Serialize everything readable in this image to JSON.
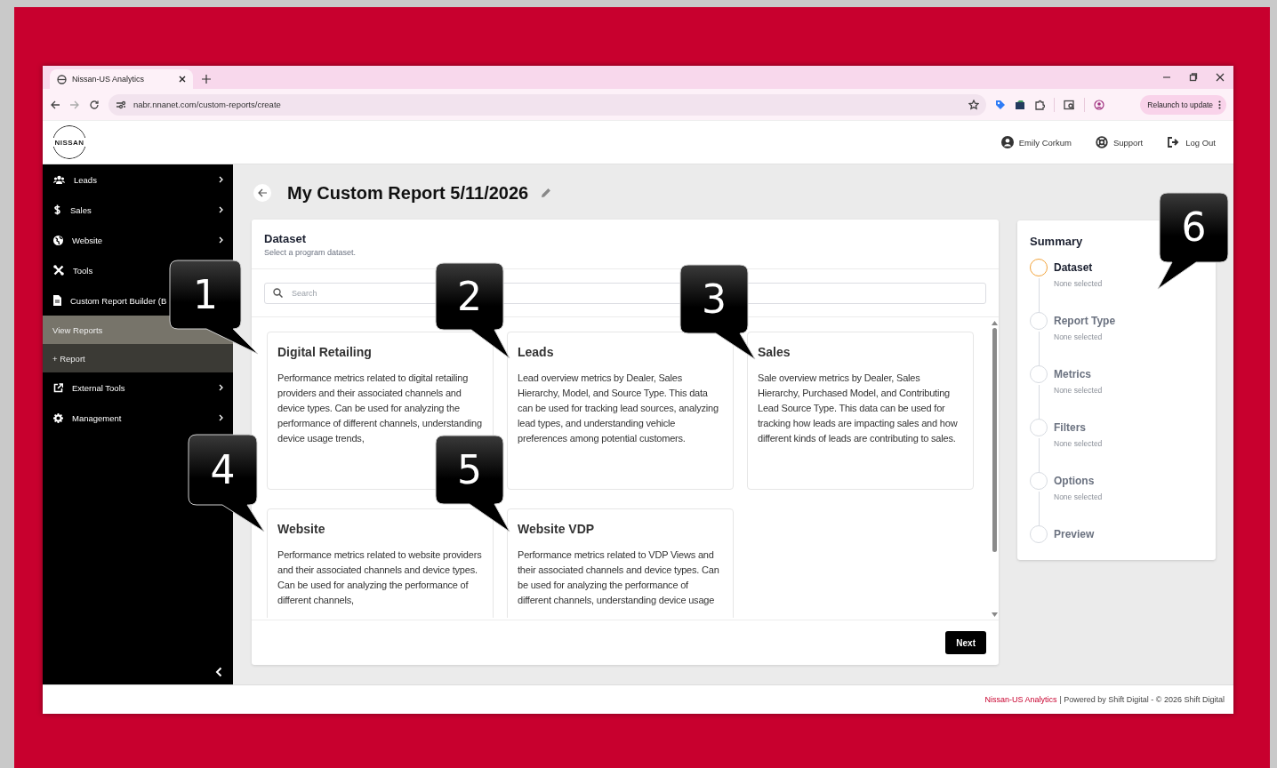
{
  "browser": {
    "tab_title": "Nissan-US Analytics",
    "address": "nabr.nnanet.com/custom-reports/create",
    "relaunch_button": "Relaunch to update"
  },
  "header": {
    "logo": "NISSAN",
    "links": [
      {
        "kind": "user",
        "label": "Emily Corkum"
      },
      {
        "kind": "support",
        "label": "Support"
      },
      {
        "kind": "logout",
        "label": "Log Out"
      }
    ]
  },
  "sidebar": {
    "items": [
      {
        "kind": "group",
        "label": "Leads"
      },
      {
        "kind": "group",
        "label": "Sales"
      },
      {
        "kind": "group",
        "label": "Website"
      },
      {
        "kind": "plain",
        "label": "Tools"
      },
      {
        "kind": "plain",
        "label": "Custom Report Builder (B"
      },
      {
        "kind": "sub",
        "label": "View Reports",
        "selected": false
      },
      {
        "kind": "sub",
        "label": "+ Report",
        "selected": true
      },
      {
        "kind": "group",
        "label": "External Tools"
      },
      {
        "kind": "group",
        "label": "Management"
      }
    ]
  },
  "page": {
    "title": "My Custom Report 5/11/2026"
  },
  "dataset_panel": {
    "title": "Dataset",
    "subtitle": "Select a program dataset.",
    "search": {
      "placeholder": "Search"
    },
    "datasets": [
      {
        "title": "Digital Retailing",
        "description": "Performance metrics related to digital retailing providers and their associated channels and device types. Can be used for analyzing the performance of different channels, understanding device usage trends,"
      },
      {
        "title": "Leads",
        "description": "Lead overview metrics by Dealer, Sales Hierarchy, Model, and Source Type. This data can be used for tracking lead sources, analyzing lead types, and understanding vehicle preferences among potential customers."
      },
      {
        "title": "Sales",
        "description": "Sale overview metrics by Dealer, Sales Hierarchy, Purchased Model, and Contributing Lead Source Type. This data can be used for tracking how leads are impacting sales and how different kinds of leads are contributing to sales."
      },
      {
        "title": "Website",
        "description": "Performance metrics related to website providers and their associated channels and device types. Can be used for analyzing the performance of different channels,"
      },
      {
        "title": "Website VDP",
        "description": "Performance metrics related to VDP Views and their associated channels and device types. Can be used for analyzing the performance of different channels, understanding device usage"
      }
    ],
    "next_button": "Next"
  },
  "summary": {
    "title": "Summary",
    "steps": [
      {
        "label": "Dataset",
        "detail": "None selected",
        "selected": true
      },
      {
        "label": "Report Type",
        "detail": "None selected",
        "selected": false
      },
      {
        "label": "Metrics",
        "detail": "None selected",
        "selected": false
      },
      {
        "label": "Filters",
        "detail": "None selected",
        "selected": false
      },
      {
        "label": "Options",
        "detail": "None selected",
        "selected": false
      },
      {
        "label": "Preview",
        "selected": false
      }
    ]
  },
  "footer": {
    "link": "Nissan-US Analytics",
    "text": "| Powered by Shift Digital - © 2026 Shift Digital"
  },
  "callouts": [
    {
      "label": "1"
    },
    {
      "label": "2"
    },
    {
      "label": "3"
    },
    {
      "label": "4"
    },
    {
      "label": "5"
    },
    {
      "label": "6"
    }
  ]
}
